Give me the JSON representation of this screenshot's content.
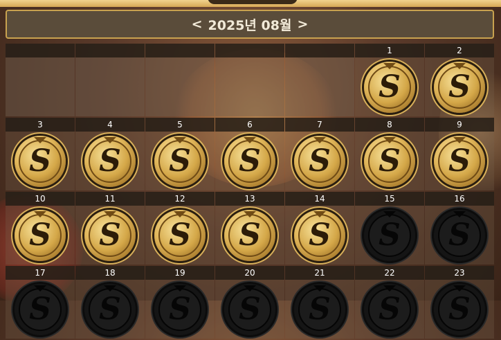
{
  "header": {
    "prev_label": "<",
    "month_label": "2025년 08월",
    "next_label": ">"
  },
  "colors": {
    "header_bg": "#5a4c3a",
    "header_border": "#c9a24f",
    "coin_gold": "#e0b65a",
    "coin_missed": "#151515"
  },
  "coin_letter": "S",
  "calendar": {
    "leading_empty": 5,
    "days": [
      {
        "day": "1",
        "status": "collected"
      },
      {
        "day": "2",
        "status": "collected"
      },
      {
        "day": "3",
        "status": "collected"
      },
      {
        "day": "4",
        "status": "collected"
      },
      {
        "day": "5",
        "status": "collected"
      },
      {
        "day": "6",
        "status": "collected"
      },
      {
        "day": "7",
        "status": "collected"
      },
      {
        "day": "8",
        "status": "collected"
      },
      {
        "day": "9",
        "status": "collected"
      },
      {
        "day": "10",
        "status": "collected"
      },
      {
        "day": "11",
        "status": "collected"
      },
      {
        "day": "12",
        "status": "collected"
      },
      {
        "day": "13",
        "status": "collected"
      },
      {
        "day": "14",
        "status": "collected"
      },
      {
        "day": "15",
        "status": "pending"
      },
      {
        "day": "16",
        "status": "pending"
      },
      {
        "day": "17",
        "status": "pending"
      },
      {
        "day": "18",
        "status": "pending"
      },
      {
        "day": "19",
        "status": "pending"
      },
      {
        "day": "20",
        "status": "pending"
      },
      {
        "day": "21",
        "status": "pending"
      },
      {
        "day": "22",
        "status": "pending"
      },
      {
        "day": "23",
        "status": "pending"
      }
    ]
  }
}
